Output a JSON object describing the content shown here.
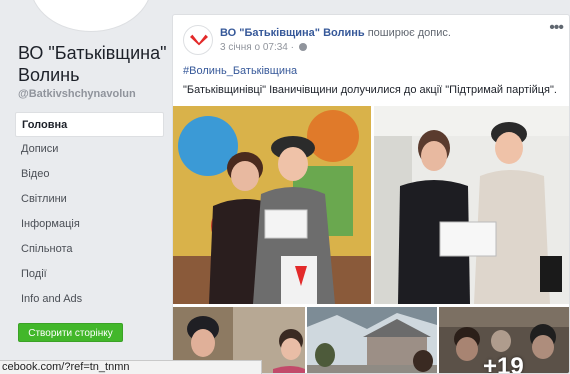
{
  "page": {
    "name": "ВО \"Батьківщина\" Волинь",
    "handle": "@Batkivshchynavolun"
  },
  "nav": {
    "items": [
      {
        "label": "Головна",
        "active": true
      },
      {
        "label": "Дописи"
      },
      {
        "label": "Відео"
      },
      {
        "label": "Світлини"
      },
      {
        "label": "Інформація"
      },
      {
        "label": "Спільнота"
      },
      {
        "label": "Події"
      },
      {
        "label": "Info and Ads"
      }
    ],
    "create_button": "Створити сторінку"
  },
  "post": {
    "author": "ВО \"Батьківщина\" Волинь",
    "action": "поширює допис.",
    "timestamp": "3 січня о 07:34",
    "hashtag": "#Волинь_Батьківщина",
    "text": "\"Батьківщинівці\" Іваничівщини долучилися до акції \"Підтримай партійця\".",
    "more_photos": "+19"
  },
  "status_bar": {
    "url": "cebook.com/?ref=tn_tnmn"
  },
  "colors": {
    "brand_red": "#e32a2a",
    "link_blue": "#365899",
    "button_green": "#42b72a"
  },
  "icons": {
    "avatar": "heart-logo-icon",
    "privacy": "globe-icon",
    "menu": "more-options-icon"
  }
}
